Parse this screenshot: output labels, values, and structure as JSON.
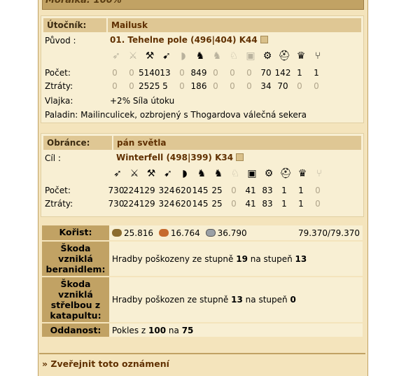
{
  "top_bar": {
    "text": "Morálka: 100%"
  },
  "attacker": {
    "header_label": "Útočník:",
    "name": "Mailusk",
    "origin_label": "Původ :",
    "origin_value": "01. Tehelne pole (496|404) K44",
    "count_label": "Počet:",
    "loss_label": "Ztráty:",
    "counts": [
      "0",
      "0",
      "5140",
      "13",
      "0",
      "849",
      "0",
      "0",
      "0",
      "70",
      "142",
      "1",
      "1"
    ],
    "losses": [
      "0",
      "0",
      "2525",
      "5",
      "0",
      "186",
      "0",
      "0",
      "0",
      "34",
      "70",
      "0",
      "0"
    ],
    "flag_label": "Vlajka:",
    "flag_value": "+2% Síla útoku",
    "paladin_text": "Paladin: Mailinculicek, ozbrojený s Thogardova válečná sekera"
  },
  "defender": {
    "header_label": "Obránce:",
    "name": "pán světla",
    "target_label": "Cíl :",
    "target_value": "Winterfell (498|399) K34",
    "count_label": "Počet:",
    "loss_label": "Ztráty:",
    "counts": [
      "730",
      "2241",
      "29",
      "324",
      "620",
      "145",
      "25",
      "0",
      "41",
      "83",
      "1",
      "1",
      "0"
    ],
    "losses": [
      "730",
      "2241",
      "29",
      "324",
      "620",
      "145",
      "25",
      "0",
      "41",
      "83",
      "1",
      "1",
      "0"
    ]
  },
  "unit_icons": [
    "spear-icon",
    "sword-icon",
    "axe-icon",
    "archer-icon",
    "spy-icon",
    "light-cavalry-icon",
    "mounted-archer-icon",
    "heavy-cavalry-icon",
    "ram-icon",
    "catapult-icon",
    "knight-icon",
    "snob-icon",
    "militia-icon"
  ],
  "loot": {
    "label": "Kořist:",
    "wood": "25.816",
    "clay": "16.764",
    "iron": "36.790",
    "total": "79.370/79.370"
  },
  "ram_damage": {
    "label": "Škoda vzniklá beranidlem:",
    "text_prefix": "Hradby poškozeny ze stupně",
    "from": "19",
    "mid": "na stupeň",
    "to": "13"
  },
  "cat_damage": {
    "label": "Škoda vzniklá střelbou z katapultu:",
    "text_prefix": "Hradby poškozen ze stupně",
    "from": "13",
    "mid": "na stupeň",
    "to": "0"
  },
  "loyalty": {
    "label": "Oddanost:",
    "prefix": "Pokles z",
    "from": "100",
    "mid": "na",
    "to": "75"
  },
  "publish": {
    "label": "» Zveřejnit toto oznámení"
  }
}
